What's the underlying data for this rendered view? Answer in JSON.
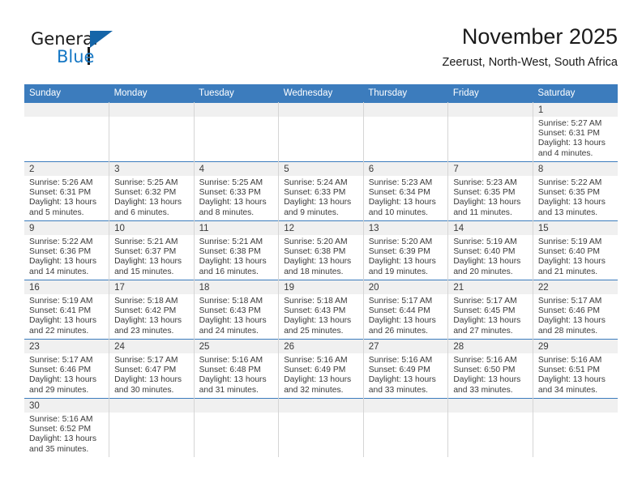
{
  "logo": {
    "word_top": "General",
    "word_bottom": "Blue",
    "accent_color": "#1577c4"
  },
  "header": {
    "title": "November 2025",
    "subtitle": "Zeerust, North-West, South Africa"
  },
  "calendar": {
    "header_color": "#3c7cbd",
    "weekdays": [
      "Sunday",
      "Monday",
      "Tuesday",
      "Wednesday",
      "Thursday",
      "Friday",
      "Saturday"
    ],
    "weeks": [
      [
        {
          "day": "",
          "sunrise": "",
          "sunset": "",
          "daylight": "",
          "daylight2": "",
          "empty": true
        },
        {
          "day": "",
          "sunrise": "",
          "sunset": "",
          "daylight": "",
          "daylight2": "",
          "empty": true
        },
        {
          "day": "",
          "sunrise": "",
          "sunset": "",
          "daylight": "",
          "daylight2": "",
          "empty": true
        },
        {
          "day": "",
          "sunrise": "",
          "sunset": "",
          "daylight": "",
          "daylight2": "",
          "empty": true
        },
        {
          "day": "",
          "sunrise": "",
          "sunset": "",
          "daylight": "",
          "daylight2": "",
          "empty": true
        },
        {
          "day": "",
          "sunrise": "",
          "sunset": "",
          "daylight": "",
          "daylight2": "",
          "empty": true
        },
        {
          "day": "1",
          "sunrise": "Sunrise: 5:27 AM",
          "sunset": "Sunset: 6:31 PM",
          "daylight": "Daylight: 13 hours",
          "daylight2": "and 4 minutes.",
          "empty": false
        }
      ],
      [
        {
          "day": "2",
          "sunrise": "Sunrise: 5:26 AM",
          "sunset": "Sunset: 6:31 PM",
          "daylight": "Daylight: 13 hours",
          "daylight2": "and 5 minutes.",
          "empty": false
        },
        {
          "day": "3",
          "sunrise": "Sunrise: 5:25 AM",
          "sunset": "Sunset: 6:32 PM",
          "daylight": "Daylight: 13 hours",
          "daylight2": "and 6 minutes.",
          "empty": false
        },
        {
          "day": "4",
          "sunrise": "Sunrise: 5:25 AM",
          "sunset": "Sunset: 6:33 PM",
          "daylight": "Daylight: 13 hours",
          "daylight2": "and 8 minutes.",
          "empty": false
        },
        {
          "day": "5",
          "sunrise": "Sunrise: 5:24 AM",
          "sunset": "Sunset: 6:33 PM",
          "daylight": "Daylight: 13 hours",
          "daylight2": "and 9 minutes.",
          "empty": false
        },
        {
          "day": "6",
          "sunrise": "Sunrise: 5:23 AM",
          "sunset": "Sunset: 6:34 PM",
          "daylight": "Daylight: 13 hours",
          "daylight2": "and 10 minutes.",
          "empty": false
        },
        {
          "day": "7",
          "sunrise": "Sunrise: 5:23 AM",
          "sunset": "Sunset: 6:35 PM",
          "daylight": "Daylight: 13 hours",
          "daylight2": "and 11 minutes.",
          "empty": false
        },
        {
          "day": "8",
          "sunrise": "Sunrise: 5:22 AM",
          "sunset": "Sunset: 6:35 PM",
          "daylight": "Daylight: 13 hours",
          "daylight2": "and 13 minutes.",
          "empty": false
        }
      ],
      [
        {
          "day": "9",
          "sunrise": "Sunrise: 5:22 AM",
          "sunset": "Sunset: 6:36 PM",
          "daylight": "Daylight: 13 hours",
          "daylight2": "and 14 minutes.",
          "empty": false
        },
        {
          "day": "10",
          "sunrise": "Sunrise: 5:21 AM",
          "sunset": "Sunset: 6:37 PM",
          "daylight": "Daylight: 13 hours",
          "daylight2": "and 15 minutes.",
          "empty": false
        },
        {
          "day": "11",
          "sunrise": "Sunrise: 5:21 AM",
          "sunset": "Sunset: 6:38 PM",
          "daylight": "Daylight: 13 hours",
          "daylight2": "and 16 minutes.",
          "empty": false
        },
        {
          "day": "12",
          "sunrise": "Sunrise: 5:20 AM",
          "sunset": "Sunset: 6:38 PM",
          "daylight": "Daylight: 13 hours",
          "daylight2": "and 18 minutes.",
          "empty": false
        },
        {
          "day": "13",
          "sunrise": "Sunrise: 5:20 AM",
          "sunset": "Sunset: 6:39 PM",
          "daylight": "Daylight: 13 hours",
          "daylight2": "and 19 minutes.",
          "empty": false
        },
        {
          "day": "14",
          "sunrise": "Sunrise: 5:19 AM",
          "sunset": "Sunset: 6:40 PM",
          "daylight": "Daylight: 13 hours",
          "daylight2": "and 20 minutes.",
          "empty": false
        },
        {
          "day": "15",
          "sunrise": "Sunrise: 5:19 AM",
          "sunset": "Sunset: 6:40 PM",
          "daylight": "Daylight: 13 hours",
          "daylight2": "and 21 minutes.",
          "empty": false
        }
      ],
      [
        {
          "day": "16",
          "sunrise": "Sunrise: 5:19 AM",
          "sunset": "Sunset: 6:41 PM",
          "daylight": "Daylight: 13 hours",
          "daylight2": "and 22 minutes.",
          "empty": false
        },
        {
          "day": "17",
          "sunrise": "Sunrise: 5:18 AM",
          "sunset": "Sunset: 6:42 PM",
          "daylight": "Daylight: 13 hours",
          "daylight2": "and 23 minutes.",
          "empty": false
        },
        {
          "day": "18",
          "sunrise": "Sunrise: 5:18 AM",
          "sunset": "Sunset: 6:43 PM",
          "daylight": "Daylight: 13 hours",
          "daylight2": "and 24 minutes.",
          "empty": false
        },
        {
          "day": "19",
          "sunrise": "Sunrise: 5:18 AM",
          "sunset": "Sunset: 6:43 PM",
          "daylight": "Daylight: 13 hours",
          "daylight2": "and 25 minutes.",
          "empty": false
        },
        {
          "day": "20",
          "sunrise": "Sunrise: 5:17 AM",
          "sunset": "Sunset: 6:44 PM",
          "daylight": "Daylight: 13 hours",
          "daylight2": "and 26 minutes.",
          "empty": false
        },
        {
          "day": "21",
          "sunrise": "Sunrise: 5:17 AM",
          "sunset": "Sunset: 6:45 PM",
          "daylight": "Daylight: 13 hours",
          "daylight2": "and 27 minutes.",
          "empty": false
        },
        {
          "day": "22",
          "sunrise": "Sunrise: 5:17 AM",
          "sunset": "Sunset: 6:46 PM",
          "daylight": "Daylight: 13 hours",
          "daylight2": "and 28 minutes.",
          "empty": false
        }
      ],
      [
        {
          "day": "23",
          "sunrise": "Sunrise: 5:17 AM",
          "sunset": "Sunset: 6:46 PM",
          "daylight": "Daylight: 13 hours",
          "daylight2": "and 29 minutes.",
          "empty": false
        },
        {
          "day": "24",
          "sunrise": "Sunrise: 5:17 AM",
          "sunset": "Sunset: 6:47 PM",
          "daylight": "Daylight: 13 hours",
          "daylight2": "and 30 minutes.",
          "empty": false
        },
        {
          "day": "25",
          "sunrise": "Sunrise: 5:16 AM",
          "sunset": "Sunset: 6:48 PM",
          "daylight": "Daylight: 13 hours",
          "daylight2": "and 31 minutes.",
          "empty": false
        },
        {
          "day": "26",
          "sunrise": "Sunrise: 5:16 AM",
          "sunset": "Sunset: 6:49 PM",
          "daylight": "Daylight: 13 hours",
          "daylight2": "and 32 minutes.",
          "empty": false
        },
        {
          "day": "27",
          "sunrise": "Sunrise: 5:16 AM",
          "sunset": "Sunset: 6:49 PM",
          "daylight": "Daylight: 13 hours",
          "daylight2": "and 33 minutes.",
          "empty": false
        },
        {
          "day": "28",
          "sunrise": "Sunrise: 5:16 AM",
          "sunset": "Sunset: 6:50 PM",
          "daylight": "Daylight: 13 hours",
          "daylight2": "and 33 minutes.",
          "empty": false
        },
        {
          "day": "29",
          "sunrise": "Sunrise: 5:16 AM",
          "sunset": "Sunset: 6:51 PM",
          "daylight": "Daylight: 13 hours",
          "daylight2": "and 34 minutes.",
          "empty": false
        }
      ],
      [
        {
          "day": "30",
          "sunrise": "Sunrise: 5:16 AM",
          "sunset": "Sunset: 6:52 PM",
          "daylight": "Daylight: 13 hours",
          "daylight2": "and 35 minutes.",
          "empty": false
        },
        {
          "day": "",
          "sunrise": "",
          "sunset": "",
          "daylight": "",
          "daylight2": "",
          "empty": true
        },
        {
          "day": "",
          "sunrise": "",
          "sunset": "",
          "daylight": "",
          "daylight2": "",
          "empty": true
        },
        {
          "day": "",
          "sunrise": "",
          "sunset": "",
          "daylight": "",
          "daylight2": "",
          "empty": true
        },
        {
          "day": "",
          "sunrise": "",
          "sunset": "",
          "daylight": "",
          "daylight2": "",
          "empty": true
        },
        {
          "day": "",
          "sunrise": "",
          "sunset": "",
          "daylight": "",
          "daylight2": "",
          "empty": true
        },
        {
          "day": "",
          "sunrise": "",
          "sunset": "",
          "daylight": "",
          "daylight2": "",
          "empty": true
        }
      ]
    ]
  }
}
